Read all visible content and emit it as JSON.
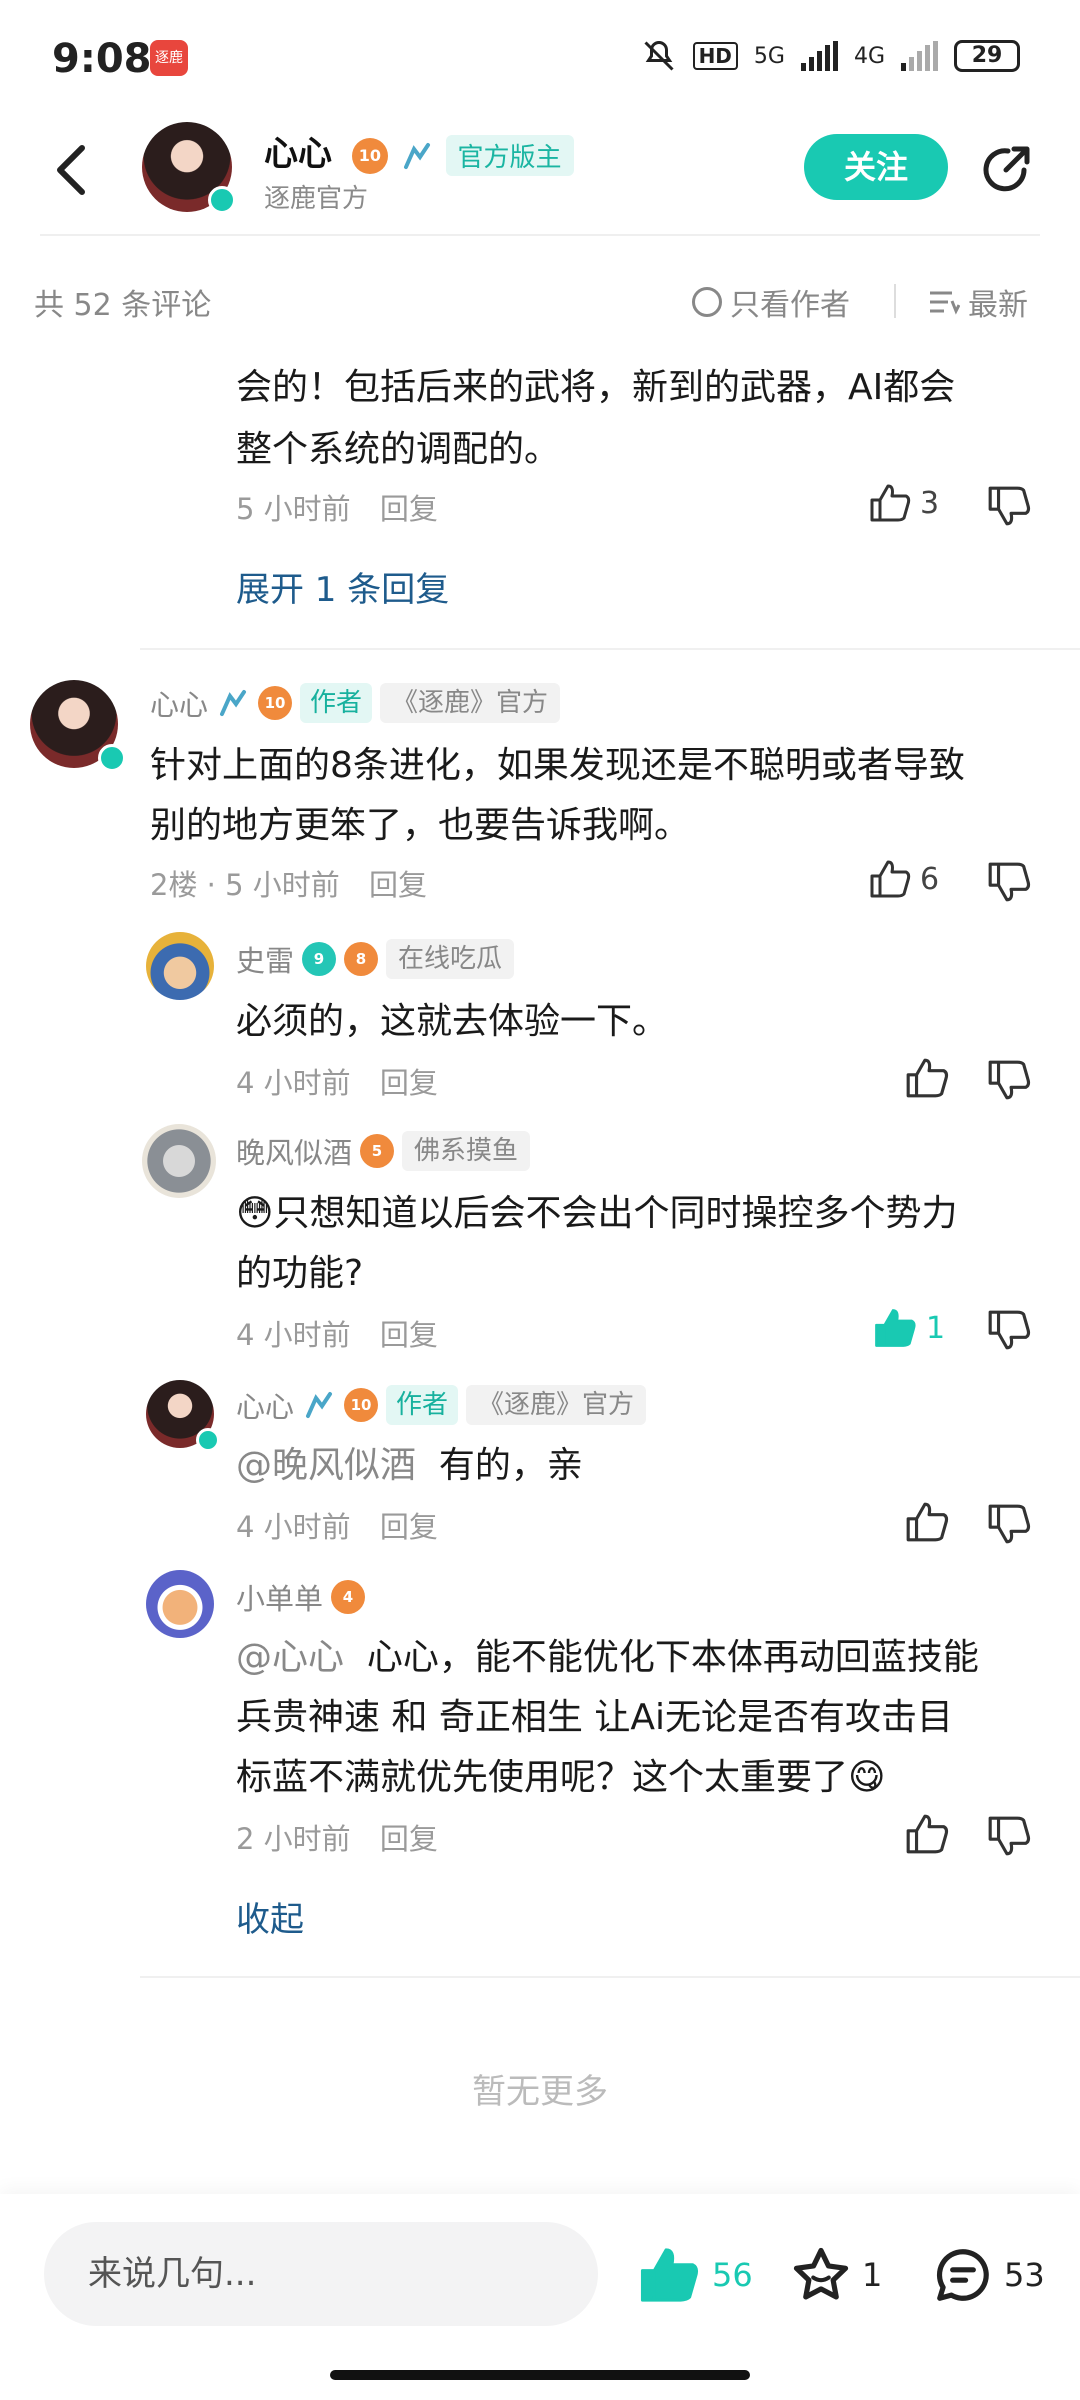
{
  "status_bar": {
    "time": "9:08",
    "app_icon_text": "逐鹿",
    "hd_label": "HD",
    "net1": "5G",
    "net2": "4G",
    "battery": "29"
  },
  "header": {
    "name": "心心",
    "level": "10",
    "official_tag": "官方版主",
    "subtitle": "逐鹿官方",
    "follow_label": "关注"
  },
  "toolbar": {
    "count_label": "共 52 条评论",
    "only_author_label": "只看作者",
    "sort_label": "最新"
  },
  "comments": {
    "c1": {
      "text_line1": "会的！包括后来的武将，新到的武器，AI都会",
      "text_line2": "整个系统的调配的。",
      "time": "5 小时前",
      "reply_label": "回复",
      "likes": "3",
      "expand_label": "展开 1 条回复"
    },
    "c2": {
      "username": "心心",
      "level": "10",
      "tag_author": "作者",
      "tag_title": "《逐鹿》官方",
      "text_line1": "针对上面的8条进化，如果发现还是不聪明或者导致",
      "text_line2": "别的地方更笨了，也要告诉我啊。",
      "floor_time": "2楼 · 5 小时前",
      "reply_label": "回复",
      "likes": "6"
    },
    "r1": {
      "username": "史雷",
      "badge": "9",
      "level": "8",
      "tag": "在线吃瓜",
      "text": "必须的，这就去体验一下。",
      "time": "4 小时前",
      "reply_label": "回复"
    },
    "r2": {
      "username": "晚风似酒",
      "level": "5",
      "tag": "佛系摸鱼",
      "emoji": "😳",
      "text_line1": "只想知道以后会不会出个同时操控多个势力",
      "text_line2": "的功能?",
      "time": "4 小时前",
      "reply_label": "回复",
      "likes": "1"
    },
    "r3": {
      "username": "心心",
      "level": "10",
      "tag_author": "作者",
      "tag_title": "《逐鹿》官方",
      "mention": "@晚风似酒",
      "text": "有的，亲",
      "time": "4 小时前",
      "reply_label": "回复"
    },
    "r4": {
      "username": "小单单",
      "level": "4",
      "mention": "@心心",
      "text_line1": "心心，能不能优化下本体再动回蓝技能",
      "text_line2": "兵贵神速 和 奇正相生 让Ai无论是否有攻击目",
      "text_line3": "标蓝不满就优先使用呢？这个太重要了",
      "emoji": "😋",
      "time": "2 小时前",
      "reply_label": "回复"
    },
    "collapse_label": "收起"
  },
  "no_more": "暂无更多",
  "bottom_bar": {
    "input_placeholder": "来说几句...",
    "likes": "56",
    "favorites": "1",
    "comments": "53"
  },
  "colors": {
    "accent": "#19c9b2",
    "link": "#1e5b8c",
    "level_badge": "#f08a3c"
  }
}
